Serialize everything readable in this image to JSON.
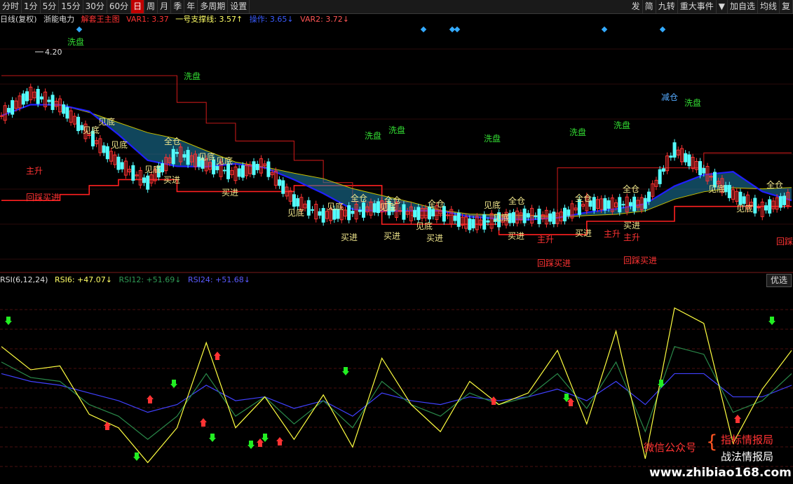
{
  "toolbar": {
    "left_items": [
      "分时",
      "1分",
      "5分",
      "15分",
      "30分",
      "60分",
      "日",
      "周",
      "月",
      "季",
      "年",
      "多周期",
      "设置"
    ],
    "active": "日",
    "right_items": [
      "发",
      "简",
      "九转",
      "重大事件",
      "▼",
      "加自选",
      "均线",
      "复"
    ]
  },
  "main_header": {
    "period": "日线(复权)",
    "stock": "浙能电力",
    "indicator": "解套王主图",
    "var1": "VAR1: 3.37",
    "support": "一号支撑线: 3.57↑",
    "op": "操作: 3.65↓",
    "var2": "VAR2: 3.72↓"
  },
  "rsi_header": {
    "name": "RSI(6,12,24)",
    "rsi6": "RSI6: +47.07↓",
    "rsi12": "RSI12: +51.69↓",
    "rsi24": "RSI24: +51.68↓"
  },
  "options_button": "优选",
  "price_label": "4.20",
  "signal_labels": [
    {
      "text": "洗盘",
      "color": "#33dd33"
    },
    {
      "text": "洗盘",
      "color": "#33dd33"
    },
    {
      "text": "洗盘",
      "color": "#33dd33"
    },
    {
      "text": "洗盘",
      "color": "#33dd33"
    },
    {
      "text": "洗盘",
      "color": "#33dd33"
    },
    {
      "text": "洗盘",
      "color": "#33dd33"
    },
    {
      "text": "洗盘",
      "color": "#33dd33"
    },
    {
      "text": "洗盘",
      "color": "#33dd33"
    },
    {
      "text": "减仓",
      "color": "#55aaff"
    },
    {
      "text": "见底",
      "color": "#f0e68c"
    },
    {
      "text": "见底",
      "color": "#f0e68c"
    },
    {
      "text": "见底",
      "color": "#f0e68c"
    },
    {
      "text": "见底",
      "color": "#f0e68c"
    },
    {
      "text": "见底",
      "color": "#f0e68c"
    },
    {
      "text": "见底",
      "color": "#f0e68c"
    },
    {
      "text": "见底",
      "color": "#f0e68c"
    },
    {
      "text": "见底",
      "color": "#f0e68c"
    },
    {
      "text": "见底",
      "color": "#f0e68c"
    },
    {
      "text": "见底",
      "color": "#f0e68c"
    },
    {
      "text": "见底",
      "color": "#f0e68c"
    },
    {
      "text": "见底",
      "color": "#f0e68c"
    },
    {
      "text": "见底",
      "color": "#f0e68c"
    },
    {
      "text": "见底",
      "color": "#f0e68c"
    },
    {
      "text": "全仓",
      "color": "#f0e68c"
    },
    {
      "text": "全仓",
      "color": "#f0e68c"
    },
    {
      "text": "全仓",
      "color": "#f0e68c"
    },
    {
      "text": "全仓",
      "color": "#f0e68c"
    },
    {
      "text": "全仓",
      "color": "#f0e68c"
    },
    {
      "text": "全仓",
      "color": "#f0e68c"
    },
    {
      "text": "全仓",
      "color": "#f0e68c"
    },
    {
      "text": "全仓",
      "color": "#f0e68c"
    },
    {
      "text": "买进",
      "color": "#f0e68c"
    },
    {
      "text": "买进",
      "color": "#f0e68c"
    },
    {
      "text": "买进",
      "color": "#f0e68c"
    },
    {
      "text": "买进",
      "color": "#f0e68c"
    },
    {
      "text": "买进",
      "color": "#f0e68c"
    },
    {
      "text": "买进",
      "color": "#f0e68c"
    },
    {
      "text": "买进",
      "color": "#f0e68c"
    },
    {
      "text": "买进",
      "color": "#f0e68c"
    },
    {
      "text": "主升",
      "color": "#ff3333"
    },
    {
      "text": "主升",
      "color": "#ff3333"
    },
    {
      "text": "主升",
      "color": "#ff3333"
    },
    {
      "text": "主升",
      "color": "#ff3333"
    },
    {
      "text": "回踩买进",
      "color": "#ff3333"
    },
    {
      "text": "回踩买进",
      "color": "#ff3333"
    },
    {
      "text": "回踩买进",
      "color": "#ff3333"
    },
    {
      "text": "回踩",
      "color": "#ff3333"
    }
  ],
  "watermark": {
    "wechat": "微信公众号",
    "name1": "指标情报局",
    "name2": "战法情报局",
    "url": "www.zhibiao168.com"
  },
  "colors": {
    "up": "#ff3232",
    "down": "#54fcfc",
    "support_line": "#ff2020",
    "ma_blue": "#2020ff",
    "ma_yellow": "#c8c000",
    "rsi6": "#ffff40",
    "rsi12": "#2a8a4a",
    "rsi24": "#4040ff"
  },
  "chart_data": {
    "type": "line",
    "main_panel": {
      "y_label_max": 4.2,
      "support_step_line": [
        3.18,
        3.18,
        3.22,
        3.28,
        3.32,
        3.32,
        3.24,
        3.24,
        3.24,
        3.24,
        3.28,
        3.28,
        3.28,
        3.02,
        3.02,
        3.02,
        3.02,
        2.95,
        2.95,
        2.95,
        3.04,
        3.04,
        3.04,
        3.14,
        3.14,
        3.14,
        3.14,
        3.14
      ],
      "resistance_step_line": [
        4.02,
        4.02,
        4.02,
        4.02,
        4.02,
        4.02,
        3.84,
        3.7,
        3.58,
        3.58,
        3.45,
        3.3,
        3.17,
        3.17,
        3.08,
        3.08,
        3.08,
        3.08,
        3.08,
        3.4,
        3.4,
        3.4,
        3.4,
        3.4,
        3.5,
        3.5,
        3.5,
        3.5
      ],
      "price_line": [
        3.75,
        3.9,
        3.82,
        3.62,
        3.43,
        3.3,
        3.5,
        3.42,
        3.36,
        3.42,
        3.18,
        3.08,
        3.1,
        3.14,
        3.09,
        3.1,
        3.02,
        3.05,
        3.08,
        3.06,
        3.16,
        3.15,
        3.16,
        3.52,
        3.38,
        3.22,
        3.12,
        3.2
      ]
    },
    "rsi_panel": {
      "ylim": [
        0,
        100
      ],
      "rsi6": [
        70,
        58,
        60,
        35,
        28,
        10,
        28,
        72,
        28,
        44,
        22,
        45,
        18,
        64,
        40,
        26,
        52,
        40,
        46,
        68,
        30,
        78,
        12,
        90,
        82,
        20,
        48,
        68
      ],
      "rsi12": [
        62,
        54,
        52,
        40,
        34,
        22,
        34,
        56,
        34,
        44,
        30,
        42,
        28,
        52,
        40,
        34,
        46,
        40,
        44,
        56,
        38,
        62,
        26,
        70,
        66,
        36,
        42,
        56
      ],
      "rsi24": [
        56,
        52,
        50,
        46,
        42,
        36,
        40,
        50,
        42,
        44,
        38,
        42,
        34,
        46,
        42,
        40,
        44,
        42,
        44,
        48,
        42,
        52,
        40,
        56,
        56,
        44,
        44,
        50
      ]
    }
  }
}
